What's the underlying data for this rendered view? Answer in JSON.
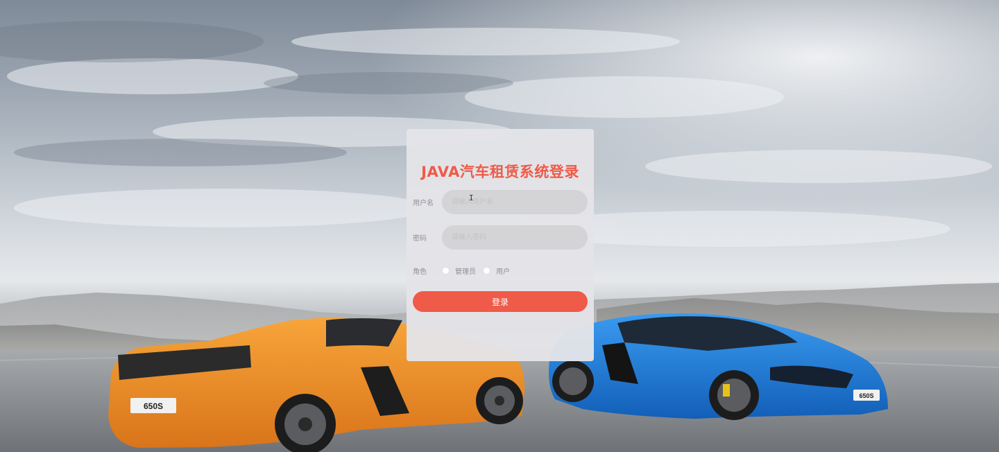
{
  "login": {
    "title": "JAVA汽车租赁系统登录",
    "username_label": "用户名",
    "username_placeholder": "请输入用户名",
    "password_label": "密码",
    "password_placeholder": "请输入密码",
    "role_label": "角色",
    "role_options": [
      {
        "label": "管理员",
        "selected": false
      },
      {
        "label": "用户",
        "selected": false
      }
    ],
    "submit_label": "登录"
  },
  "background": {
    "left_car_plate": "650S",
    "right_car_plate": "650S"
  },
  "colors": {
    "accent": "#f05a48",
    "panel": "#e4e4e8",
    "input": "#d4d4d7",
    "left_car": "#f0902a",
    "right_car": "#1f7ad6"
  }
}
